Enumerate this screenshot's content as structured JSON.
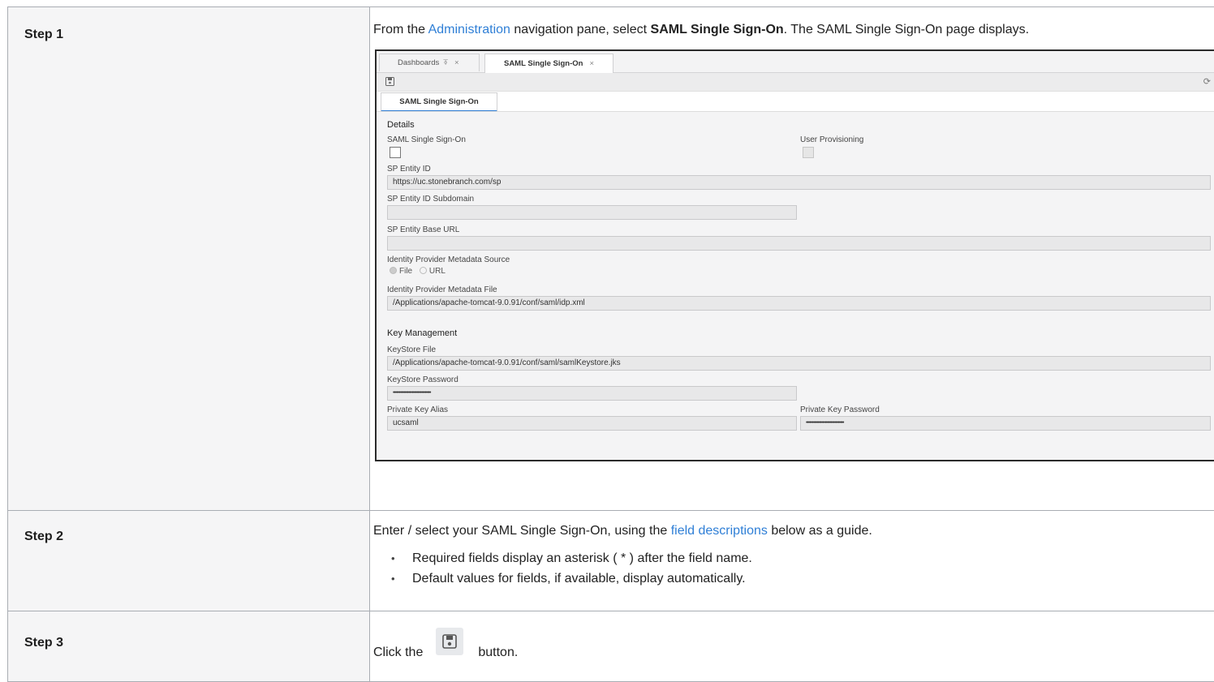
{
  "steps": [
    {
      "label": "Step 1",
      "text_before": "From the ",
      "link": "Administration",
      "text_mid": " navigation pane, select ",
      "bold": "SAML Single Sign-On",
      "text_after": ". The SAML Single Sign-On page displays."
    },
    {
      "label": "Step 2",
      "text_before": "Enter / select your SAML Single Sign-On, using the ",
      "link": "field descriptions",
      "text_after": " below as a guide.",
      "bullets": [
        "Required fields display an asterisk ( * ) after the field name.",
        "Default values for fields, if available, display automatically."
      ]
    },
    {
      "label": "Step 3",
      "text_before": "Click the",
      "text_after": "button.",
      "button_icon": "save-icon"
    }
  ],
  "screenshot": {
    "tabs": [
      {
        "label": "Dashboards",
        "pin": "⍕",
        "close": "×"
      },
      {
        "label": "SAML Single Sign-On",
        "close": "×"
      }
    ],
    "subtab": "SAML Single Sign-On",
    "details_title": "Details",
    "saml_sso_label": "SAML Single Sign-On",
    "user_provisioning_label": "User Provisioning",
    "sp_entity_id_label": "SP Entity ID",
    "sp_entity_id_value": "https://uc.stonebranch.com/sp",
    "sp_entity_id_subdomain_label": "SP Entity ID Subdomain",
    "sp_entity_base_url_label": "SP Entity Base URL",
    "idp_metadata_source_label": "Identity Provider Metadata Source",
    "idp_source_options": [
      "File",
      "URL"
    ],
    "idp_metadata_file_label": "Identity Provider Metadata File",
    "idp_metadata_file_value": "/Applications/apache-tomcat-9.0.91/conf/saml/idp.xml",
    "key_mgmt_title": "Key Management",
    "keystore_file_label": "KeyStore File",
    "keystore_file_value": "/Applications/apache-tomcat-9.0.91/conf/saml/samlKeystore.jks",
    "keystore_password_label": "KeyStore Password",
    "keystore_password_value": "••••••••••••••••••••••••••••••••",
    "private_key_alias_label": "Private Key Alias",
    "private_key_alias_value": "ucsaml",
    "private_key_password_label": "Private Key Password",
    "private_key_password_value": "••••••••••••••••••••••••••••••••",
    "icons": {
      "save": "save-icon",
      "refresh": "refresh-icon"
    }
  },
  "colors": {
    "link": "#2f7fd6",
    "border": "#a9adb3",
    "step_bg": "#f5f5f6"
  }
}
